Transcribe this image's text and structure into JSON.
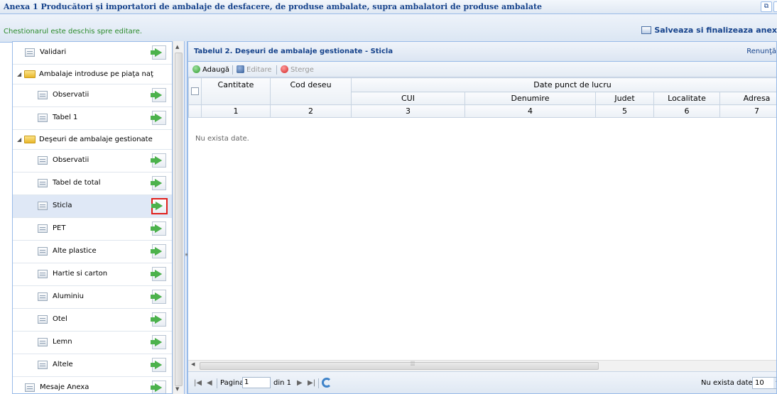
{
  "window": {
    "title": "Anexa 1 Producători şi importatori de ambalaje de desfacere, de produse ambalate, supra ambalatori de produse ambalate"
  },
  "infobar": {
    "status": "Chestionarul este deschis spre editare.",
    "save_label": "Salveaza si finalizeaza anex"
  },
  "tree": {
    "validari": "Validari",
    "group1": "Ambalaje introduse pe piaţa naţ",
    "g1_observatii": "Observatii",
    "g1_tabel1": "Tabel 1",
    "group2": "Deşeuri de ambalaje gestionate",
    "g2_observatii": "Observatii",
    "g2_tabel_total": "Tabel de total",
    "g2_sticla": "Sticla",
    "g2_pet": "PET",
    "g2_alte_plastice": "Alte plastice",
    "g2_hartie": "Hartie si carton",
    "g2_aluminiu": "Aluminiu",
    "g2_otel": "Otel",
    "g2_lemn": "Lemn",
    "g2_altele": "Altele",
    "mesaje": "Mesaje Anexa"
  },
  "panel": {
    "title": "Tabelul 2. Deşeuri de ambalaje gestionate - Sticla",
    "close_label": "Renunţă"
  },
  "toolbar": {
    "add": "Adaugă",
    "edit": "Editare",
    "delete": "Sterge"
  },
  "grid": {
    "col_cantitate": "Cantitate",
    "col_cod": "Cod deseu",
    "group_header": "Date punct de lucru",
    "col_cui": "CUI",
    "col_denumire": "Denumire",
    "col_judet": "Judet",
    "col_localitate": "Localitate",
    "col_adresa": "Adresa",
    "nums": [
      "1",
      "2",
      "3",
      "4",
      "5",
      "6",
      "7"
    ],
    "empty": "Nu exista date."
  },
  "pager": {
    "page_label": "Pagina",
    "page_value": "1",
    "of_label": "din 1",
    "no_data": "Nu exista date",
    "page_size": "10"
  },
  "colors": {
    "accent": "#15428b",
    "status_green": "#2a8a2a",
    "highlight_red": "#e0201c"
  }
}
